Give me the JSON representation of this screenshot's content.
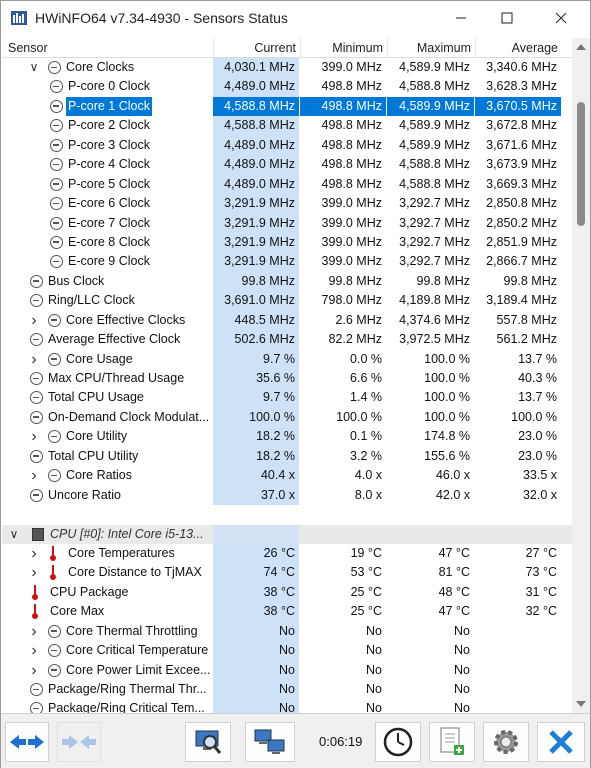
{
  "window": {
    "title": "HWiNFO64 v7.34-4930 - Sensors Status"
  },
  "columns": {
    "sensor": "Sensor",
    "current": "Current",
    "minimum": "Minimum",
    "maximum": "Maximum",
    "average": "Average"
  },
  "rows": [
    {
      "indent": 1,
      "chev": "v",
      "icon": "gauge",
      "name": "Core Clocks",
      "cur": "4,030.1 MHz",
      "min": "399.0 MHz",
      "max": "4,589.9 MHz",
      "avg": "3,340.6 MHz"
    },
    {
      "indent": 2,
      "icon": "gauge",
      "name": "P-core 0 Clock",
      "cur": "4,489.0 MHz",
      "min": "498.8 MHz",
      "max": "4,588.8 MHz",
      "avg": "3,628.3 MHz"
    },
    {
      "indent": 2,
      "icon": "gauge",
      "name": "P-core 1 Clock",
      "cur": "4,588.8 MHz",
      "min": "498.8 MHz",
      "max": "4,589.9 MHz",
      "avg": "3,670.5 MHz",
      "selected": true
    },
    {
      "indent": 2,
      "icon": "gauge",
      "name": "P-core 2 Clock",
      "cur": "4,588.8 MHz",
      "min": "498.8 MHz",
      "max": "4,589.9 MHz",
      "avg": "3,672.8 MHz"
    },
    {
      "indent": 2,
      "icon": "gauge",
      "name": "P-core 3 Clock",
      "cur": "4,489.0 MHz",
      "min": "498.8 MHz",
      "max": "4,589.9 MHz",
      "avg": "3,671.6 MHz"
    },
    {
      "indent": 2,
      "icon": "gauge",
      "name": "P-core 4 Clock",
      "cur": "4,489.0 MHz",
      "min": "498.8 MHz",
      "max": "4,588.8 MHz",
      "avg": "3,673.9 MHz"
    },
    {
      "indent": 2,
      "icon": "gauge",
      "name": "P-core 5 Clock",
      "cur": "4,489.0 MHz",
      "min": "498.8 MHz",
      "max": "4,588.8 MHz",
      "avg": "3,669.3 MHz"
    },
    {
      "indent": 2,
      "icon": "gauge",
      "name": "E-core 6 Clock",
      "cur": "3,291.9 MHz",
      "min": "399.0 MHz",
      "max": "3,292.7 MHz",
      "avg": "2,850.8 MHz"
    },
    {
      "indent": 2,
      "icon": "gauge",
      "name": "E-core 7 Clock",
      "cur": "3,291.9 MHz",
      "min": "399.0 MHz",
      "max": "3,292.7 MHz",
      "avg": "2,850.2 MHz"
    },
    {
      "indent": 2,
      "icon": "gauge",
      "name": "E-core 8 Clock",
      "cur": "3,291.9 MHz",
      "min": "399.0 MHz",
      "max": "3,292.7 MHz",
      "avg": "2,851.9 MHz"
    },
    {
      "indent": 2,
      "icon": "gauge",
      "name": "E-core 9 Clock",
      "cur": "3,291.9 MHz",
      "min": "399.0 MHz",
      "max": "3,292.7 MHz",
      "avg": "2,866.7 MHz"
    },
    {
      "indent": 0,
      "icon": "gauge",
      "name": "Bus Clock",
      "cur": "99.8 MHz",
      "min": "99.8 MHz",
      "max": "99.8 MHz",
      "avg": "99.8 MHz"
    },
    {
      "indent": 0,
      "icon": "gauge",
      "name": "Ring/LLC Clock",
      "cur": "3,691.0 MHz",
      "min": "798.0 MHz",
      "max": "4,189.8 MHz",
      "avg": "3,189.4 MHz"
    },
    {
      "indent": 1,
      "chev": ">",
      "icon": "gauge",
      "name": "Core Effective Clocks",
      "cur": "448.5 MHz",
      "min": "2.6 MHz",
      "max": "4,374.6 MHz",
      "avg": "557.8 MHz"
    },
    {
      "indent": 0,
      "icon": "gauge",
      "name": "Average Effective Clock",
      "cur": "502.6 MHz",
      "min": "82.2 MHz",
      "max": "3,972.5 MHz",
      "avg": "561.2 MHz"
    },
    {
      "indent": 1,
      "chev": ">",
      "icon": "gauge",
      "name": "Core Usage",
      "cur": "9.7 %",
      "min": "0.0 %",
      "max": "100.0 %",
      "avg": "13.7 %"
    },
    {
      "indent": 0,
      "icon": "gauge",
      "name": "Max CPU/Thread Usage",
      "cur": "35.6 %",
      "min": "6.6 %",
      "max": "100.0 %",
      "avg": "40.3 %"
    },
    {
      "indent": 0,
      "icon": "gauge",
      "name": "Total CPU Usage",
      "cur": "9.7 %",
      "min": "1.4 %",
      "max": "100.0 %",
      "avg": "13.7 %"
    },
    {
      "indent": 0,
      "icon": "gauge",
      "name": "On-Demand Clock Modulat...",
      "cur": "100.0 %",
      "min": "100.0 %",
      "max": "100.0 %",
      "avg": "100.0 %"
    },
    {
      "indent": 1,
      "chev": ">",
      "icon": "gauge",
      "name": "Core Utility",
      "cur": "18.2 %",
      "min": "0.1 %",
      "max": "174.8 %",
      "avg": "23.0 %"
    },
    {
      "indent": 0,
      "icon": "gauge",
      "name": "Total CPU Utility",
      "cur": "18.2 %",
      "min": "3.2 %",
      "max": "155.6 %",
      "avg": "23.0 %"
    },
    {
      "indent": 1,
      "chev": ">",
      "icon": "gauge",
      "name": "Core Ratios",
      "cur": "40.4 x",
      "min": "4.0 x",
      "max": "46.0 x",
      "avg": "33.5 x"
    },
    {
      "indent": 0,
      "icon": "gauge",
      "name": "Uncore Ratio",
      "cur": "37.0 x",
      "min": "8.0 x",
      "max": "42.0 x",
      "avg": "32.0 x"
    },
    {
      "spacer": true
    },
    {
      "group": true,
      "chev": "v",
      "icon": "chip",
      "name": "CPU [#0]: Intel Core i5-13..."
    },
    {
      "indent": 1,
      "chev": ">",
      "icon": "therm",
      "name": "Core Temperatures",
      "cur": "26 °C",
      "min": "19 °C",
      "max": "47 °C",
      "avg": "27 °C"
    },
    {
      "indent": 1,
      "chev": ">",
      "icon": "therm",
      "name": "Core Distance to TjMAX",
      "cur": "74 °C",
      "min": "53 °C",
      "max": "81 °C",
      "avg": "73 °C"
    },
    {
      "indent": 0,
      "icon": "therm",
      "name": "CPU Package",
      "cur": "38 °C",
      "min": "25 °C",
      "max": "48 °C",
      "avg": "31 °C"
    },
    {
      "indent": 0,
      "icon": "therm",
      "name": "Core Max",
      "cur": "38 °C",
      "min": "25 °C",
      "max": "47 °C",
      "avg": "32 °C"
    },
    {
      "indent": 1,
      "chev": ">",
      "icon": "gauge",
      "name": "Core Thermal Throttling",
      "cur": "No",
      "min": "No",
      "max": "No",
      "avg": ""
    },
    {
      "indent": 1,
      "chev": ">",
      "icon": "gauge",
      "name": "Core Critical Temperature",
      "cur": "No",
      "min": "No",
      "max": "No",
      "avg": ""
    },
    {
      "indent": 1,
      "chev": ">",
      "icon": "gauge",
      "name": "Core Power Limit Excee...",
      "cur": "No",
      "min": "No",
      "max": "No",
      "avg": ""
    },
    {
      "indent": 0,
      "icon": "gauge",
      "name": "Package/Ring Thermal Thr...",
      "cur": "No",
      "min": "No",
      "max": "No",
      "avg": ""
    },
    {
      "indent": 0,
      "icon": "gauge",
      "name": "Package/Ring Critical Tem...",
      "cur": "No",
      "min": "No",
      "max": "No",
      "avg": ""
    }
  ],
  "toolbar": {
    "elapsed": "0:06:19",
    "buttons": [
      "nav-left-right-icon",
      "nav-collapse-icon",
      "monitor-search-icon",
      "network-computers-icon",
      "clock-icon",
      "report-add-icon",
      "settings-gear-icon",
      "close-x-icon"
    ]
  },
  "colors": {
    "selection": "#0078d7",
    "current_col": "#cde2f7",
    "close_blue": "#1e7fd6"
  }
}
